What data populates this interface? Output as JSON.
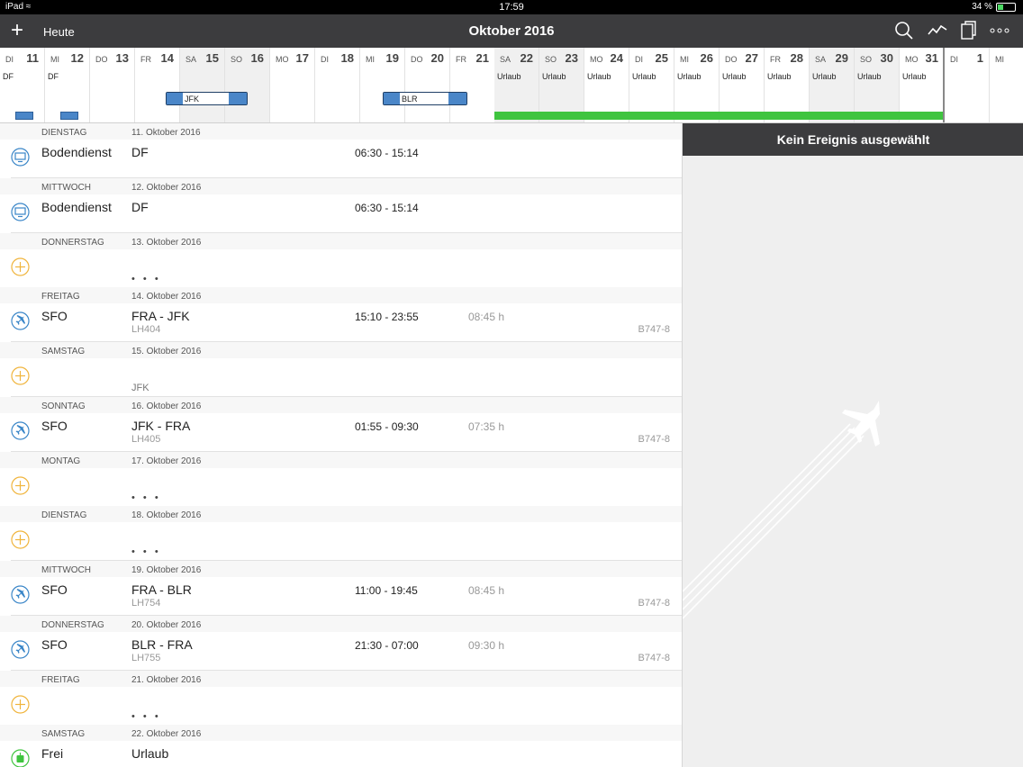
{
  "status_bar": {
    "device": "iPad",
    "time": "17:59",
    "battery": "34 %"
  },
  "nav": {
    "today_label": "Heute",
    "title": "Oktober 2016"
  },
  "calendar": {
    "days": [
      {
        "wd": "DI",
        "dn": "11",
        "ev": "DF"
      },
      {
        "wd": "MI",
        "dn": "12",
        "ev": "DF"
      },
      {
        "wd": "DO",
        "dn": "13",
        "ev": ""
      },
      {
        "wd": "FR",
        "dn": "14",
        "ev": ""
      },
      {
        "wd": "SA",
        "dn": "15",
        "ev": ""
      },
      {
        "wd": "SO",
        "dn": "16",
        "ev": ""
      },
      {
        "wd": "MO",
        "dn": "17",
        "ev": ""
      },
      {
        "wd": "DI",
        "dn": "18",
        "ev": ""
      },
      {
        "wd": "MI",
        "dn": "19",
        "ev": ""
      },
      {
        "wd": "DO",
        "dn": "20",
        "ev": ""
      },
      {
        "wd": "FR",
        "dn": "21",
        "ev": ""
      },
      {
        "wd": "SA",
        "dn": "22",
        "ev": "Urlaub"
      },
      {
        "wd": "SO",
        "dn": "23",
        "ev": "Urlaub"
      },
      {
        "wd": "MO",
        "dn": "24",
        "ev": "Urlaub"
      },
      {
        "wd": "DI",
        "dn": "25",
        "ev": "Urlaub"
      },
      {
        "wd": "MI",
        "dn": "26",
        "ev": "Urlaub"
      },
      {
        "wd": "DO",
        "dn": "27",
        "ev": "Urlaub"
      },
      {
        "wd": "FR",
        "dn": "28",
        "ev": "Urlaub"
      },
      {
        "wd": "SA",
        "dn": "29",
        "ev": "Urlaub"
      },
      {
        "wd": "SO",
        "dn": "30",
        "ev": "Urlaub"
      },
      {
        "wd": "MO",
        "dn": "31",
        "ev": "Urlaub"
      },
      {
        "wd": "DI",
        "dn": "1",
        "ev": ""
      },
      {
        "wd": "MI",
        "dn": "",
        "ev": ""
      }
    ],
    "trips": [
      "JFK",
      "BLR"
    ]
  },
  "list": [
    {
      "weekday": "DIENSTAG",
      "date": "11. Oktober 2016",
      "type": "Bodendienst",
      "route": "DF",
      "flight": "",
      "time": "06:30 - 15:14",
      "duration": "",
      "aircraft": "",
      "icon": "monitor-icon"
    },
    {
      "weekday": "MITTWOCH",
      "date": "12. Oktober 2016",
      "type": "Bodendienst",
      "route": "DF",
      "flight": "",
      "time": "06:30 - 15:14",
      "duration": "",
      "aircraft": "",
      "icon": "monitor-icon"
    },
    {
      "weekday": "DONNERSTAG",
      "date": "13. Oktober 2016",
      "type": "",
      "route": "",
      "flight": "• • •",
      "time": "",
      "duration": "",
      "aircraft": "",
      "icon": "add-icon"
    },
    {
      "weekday": "FREITAG",
      "date": "14. Oktober 2016",
      "type": "SFO",
      "route": "FRA - JFK",
      "flight": "LH404",
      "time": "15:10 - 23:55",
      "duration": "08:45 h",
      "aircraft": "B747-8",
      "icon": "airplane-icon"
    },
    {
      "weekday": "SAMSTAG",
      "date": "15. Oktober 2016",
      "type": "",
      "route": "",
      "flight": "JFK",
      "time": "",
      "duration": "",
      "aircraft": "",
      "icon": "add-icon"
    },
    {
      "weekday": "SONNTAG",
      "date": "16. Oktober 2016",
      "type": "SFO",
      "route": "JFK - FRA",
      "flight": "LH405",
      "time": "01:55 - 09:30",
      "duration": "07:35 h",
      "aircraft": "B747-8",
      "icon": "airplane-icon"
    },
    {
      "weekday": "MONTAG",
      "date": "17. Oktober 2016",
      "type": "",
      "route": "",
      "flight": "• • •",
      "time": "",
      "duration": "",
      "aircraft": "",
      "icon": "add-icon"
    },
    {
      "weekday": "DIENSTAG",
      "date": "18. Oktober 2016",
      "type": "",
      "route": "",
      "flight": "• • •",
      "time": "",
      "duration": "",
      "aircraft": "",
      "icon": "add-icon"
    },
    {
      "weekday": "MITTWOCH",
      "date": "19. Oktober 2016",
      "type": "SFO",
      "route": "FRA - BLR",
      "flight": "LH754",
      "time": "11:00 - 19:45",
      "duration": "08:45 h",
      "aircraft": "B747-8",
      "icon": "airplane-icon"
    },
    {
      "weekday": "DONNERSTAG",
      "date": "20. Oktober 2016",
      "type": "SFO",
      "route": "BLR - FRA",
      "flight": "LH755",
      "time": "21:30 - 07:00",
      "duration": "09:30 h",
      "aircraft": "B747-8",
      "icon": "airplane-icon"
    },
    {
      "weekday": "FREITAG",
      "date": "21. Oktober 2016",
      "type": "",
      "route": "",
      "flight": "• • •",
      "time": "",
      "duration": "",
      "aircraft": "",
      "icon": "add-icon"
    },
    {
      "weekday": "SAMSTAG",
      "date": "22. Oktober 2016",
      "type": "Frei",
      "route": "Urlaub",
      "flight": "",
      "time": "",
      "duration": "",
      "aircraft": "",
      "icon": "leisure-icon"
    }
  ],
  "detail": {
    "header": "Kein Ereignis ausgewählt"
  },
  "colors": {
    "nav": "#3c3c3e",
    "blue": "#4a86c8",
    "green": "#3fc43f",
    "orange": "#f0b43c"
  }
}
